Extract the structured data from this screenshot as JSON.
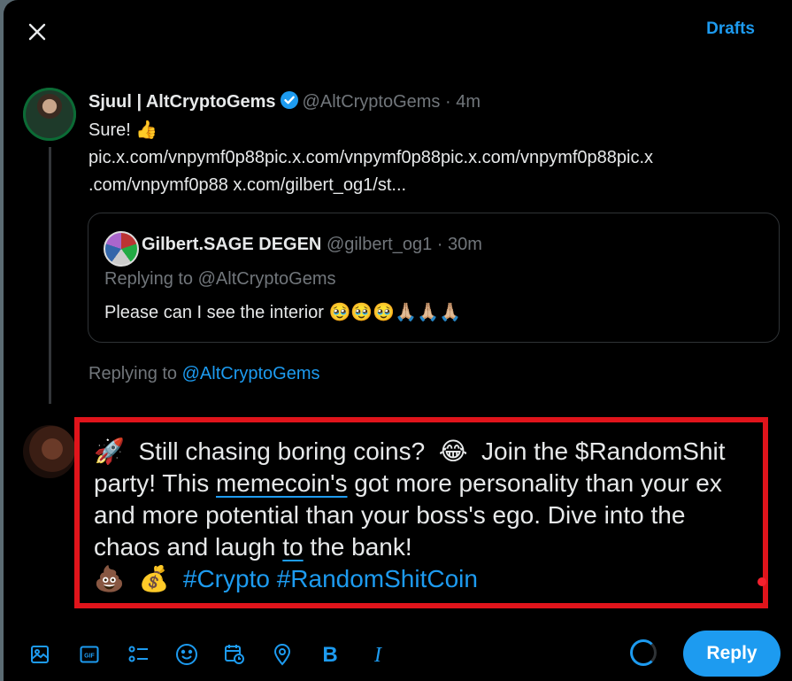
{
  "header": {
    "drafts_label": "Drafts"
  },
  "tweet": {
    "name": "Sjuul | AltCryptoGems",
    "handle": "@AltCryptoGems",
    "sep": "·",
    "time": "4m",
    "line1": "Sure! 👍",
    "line2": "pic.x.com/vnpymf0p88pic.x.com/vnpymf0p88pic.x.com/vnpymf0p88pic.x",
    "line3": ".com/vnpymf0p88 x.com/gilbert_og1/st..."
  },
  "quote": {
    "name": "Gilbert.SAGE DEGEN",
    "handle": "@gilbert_og1",
    "sep": "·",
    "time": "30m",
    "replying": "Replying to @AltCryptoGems",
    "text": "Please can I see the interior 🥹🥹🥹🙏🏼🙏🏼🙏🏼"
  },
  "replying_to": {
    "prefix": "Replying to ",
    "handle": "@AltCryptoGems"
  },
  "compose": {
    "rocket": "🚀",
    "part1": "Still chasing boring coins?",
    "laugh": "😂",
    "part2": "Join the",
    "part3": "$RandomShit party! This ",
    "underlined1": "memecoin's",
    "part4": " got more personality than your ex and more potential than your boss's ego. Dive into the chaos and laugh ",
    "underlined2": "to",
    "part5": " the bank!",
    "poop": "💩",
    "money": "💰",
    "hashtag1": "#Crypto",
    "hashtag2": "#RandomShitCoin"
  },
  "toolbar": {
    "icons": [
      "image-icon",
      "gif-icon",
      "poll-icon",
      "emoji-icon",
      "schedule-icon",
      "location-icon",
      "bold-icon",
      "italic-icon"
    ],
    "reply_label": "Reply"
  },
  "colors": {
    "accent": "#1d9bf0",
    "background": "#000000",
    "highlight_border": "#e0141b"
  }
}
